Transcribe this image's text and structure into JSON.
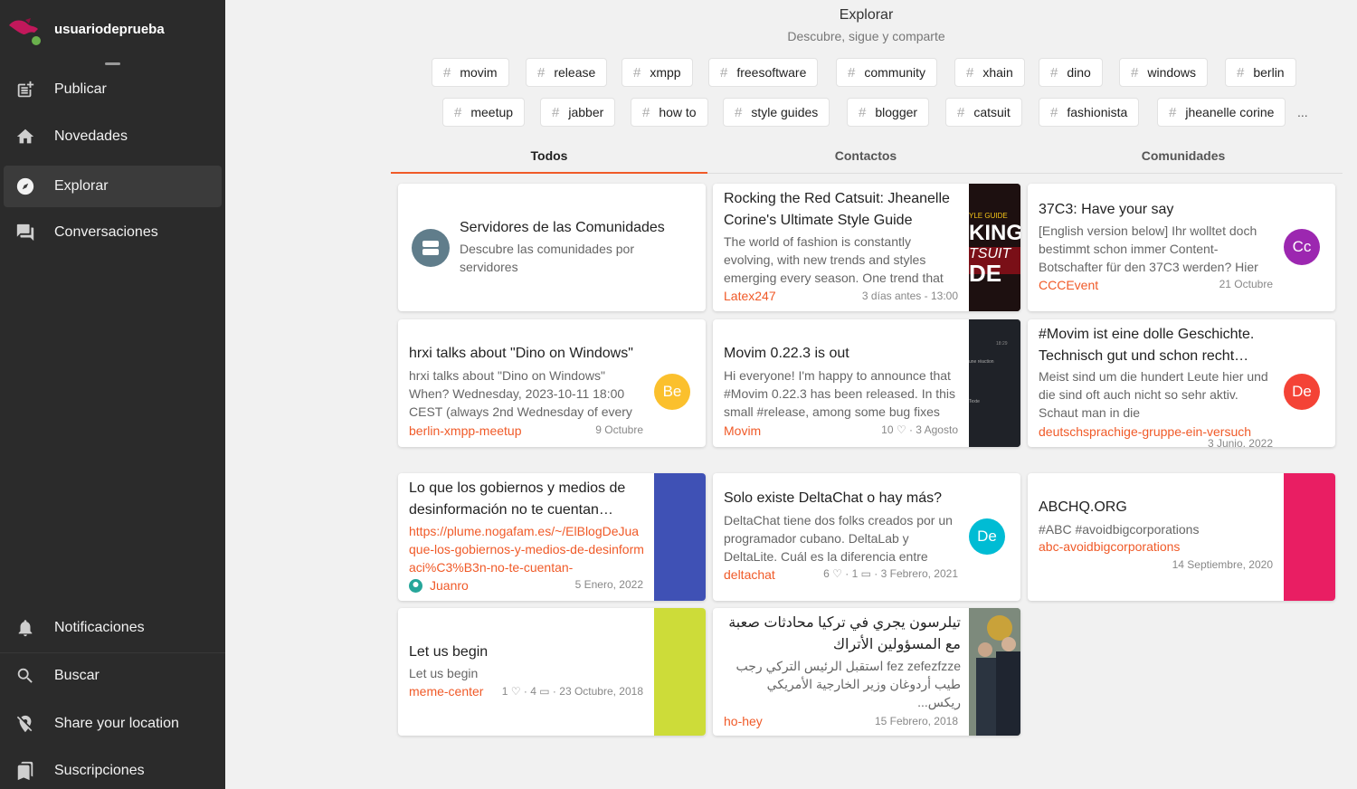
{
  "profile": {
    "name": "usuariodeprueba"
  },
  "nav": {
    "publish": "Publicar",
    "news": "Novedades",
    "explore": "Explorar",
    "chats": "Conversaciones",
    "notifications": "Notificaciones",
    "search": "Buscar",
    "location": "Share your location",
    "subscriptions": "Suscripciones"
  },
  "header": {
    "title": "Explorar",
    "subtitle": "Descubre, sigue y comparte"
  },
  "tags": [
    "movim",
    "release",
    "xmpp",
    "freesoftware",
    "community",
    "xhain",
    "dino",
    "windows",
    "berlin",
    "meetup",
    "jabber",
    "how to",
    "style guides",
    "blogger",
    "catsuit",
    "fashionista",
    "jheanelle corine"
  ],
  "tags_more": "...",
  "tabs": [
    "Todos",
    "Contactos",
    "Comunidades"
  ],
  "accent": "#f05a28",
  "cards": [
    {
      "title": "Servidores de las Comunidades",
      "text": "Descubre las comunidades por servidores",
      "icon": "server-icon"
    },
    {
      "title": "Rocking the Red Catsuit: Jheanelle Corine's Ultimate Style Guide",
      "text": "The world of fashion is constantly evolving, with new trends and styles emerging every season. One trend that",
      "source": "Latex247",
      "meta": "3 días antes - 13:00"
    },
    {
      "title": "37C3: Have your say",
      "text": "[English version below] Ihr wolltet doch bestimmt schon immer Content-Botschafter für den 37C3 werden? Hier",
      "source": "CCCEvent",
      "meta": "21 Octubre",
      "avatar": "Cc",
      "avatar_color": "#9c27b0"
    },
    {
      "title": "hrxi talks about \"Dino on Windows\"",
      "text": "hrxi talks about \"Dino on Windows\" When? Wednesday, 2023-10-11 18:00 CEST (always 2nd Wednesday of every",
      "source": "berlin-xmpp-meetup",
      "meta": "9 Octubre",
      "avatar": "Be",
      "avatar_color": "#fbc02d"
    },
    {
      "title": "Movim 0.22.3 is out",
      "text": "Hi everyone! I'm happy to announce that #Movim 0.22.3 has been released. In this small #release, among some bug fixes",
      "source": "Movim",
      "likes": "10",
      "meta_date": "3 Agosto"
    },
    {
      "title": "#Movim ist eine dolle Geschichte. Technisch gut und schon recht…",
      "text": "Meist sind um die hundert Leute hier und die sind oft auch nicht so sehr aktiv. Schaut man in die",
      "source": "deutschsprachige-gruppe-ein-versuch",
      "meta": "3 Junio, 2022",
      "avatar": "De",
      "avatar_color": "#f44336"
    },
    {
      "title": "Lo que los gobiernos y medios de desinformación no te cuentan…",
      "text": "https://plume.nogafam.es/~/ElBlogDeJuaque-los-gobiernos-y-medios-de-desinformaci%C3%B3n-no-te-cuentan-",
      "source": "Juanro",
      "meta": "5 Enero, 2022",
      "side_color": "#3f51b5"
    },
    {
      "title": "Solo existe DeltaChat o hay más?",
      "text": "DeltaChat tiene dos folks creados por un programador cubano. DeltaLab y DeltaLite. Cuál es la diferencia entre",
      "source": "deltachat",
      "likes": "6",
      "comments": "1",
      "meta_date": "3 Febrero, 2021",
      "avatar": "De",
      "avatar_color": "#00bcd4"
    },
    {
      "title": "ABCHQ.ORG",
      "text": "#ABC #avoidbigcorporations",
      "source": "abc-avoidbigcorporations",
      "meta": "14 Septiembre, 2020",
      "side_color": "#e91e63"
    },
    {
      "title": "Let us begin",
      "text": "Let us begin",
      "source": "meme-center",
      "likes": "1",
      "comments": "4",
      "meta_date": "23 Octubre, 2018",
      "side_color": "#cddc39"
    },
    {
      "title": "تيلرسون يجري في تركيا محادثات صعبة مع المسؤولين الأتراك",
      "text": "fez zefezfzze استقبل الرئيس التركي رجب طيب أردوغان وزير الخارجية الأمريكي ريكس...",
      "source": "ho-hey",
      "meta": "15 Febrero, 2018"
    }
  ],
  "thumb_text": {
    "style_guide": "YLE GUIDE",
    "big1": "KING",
    "big2": "TSUIT",
    "big3": "DE",
    "movim1": "une réaction",
    "movim2": "Texte",
    "movim3": "18:29"
  }
}
